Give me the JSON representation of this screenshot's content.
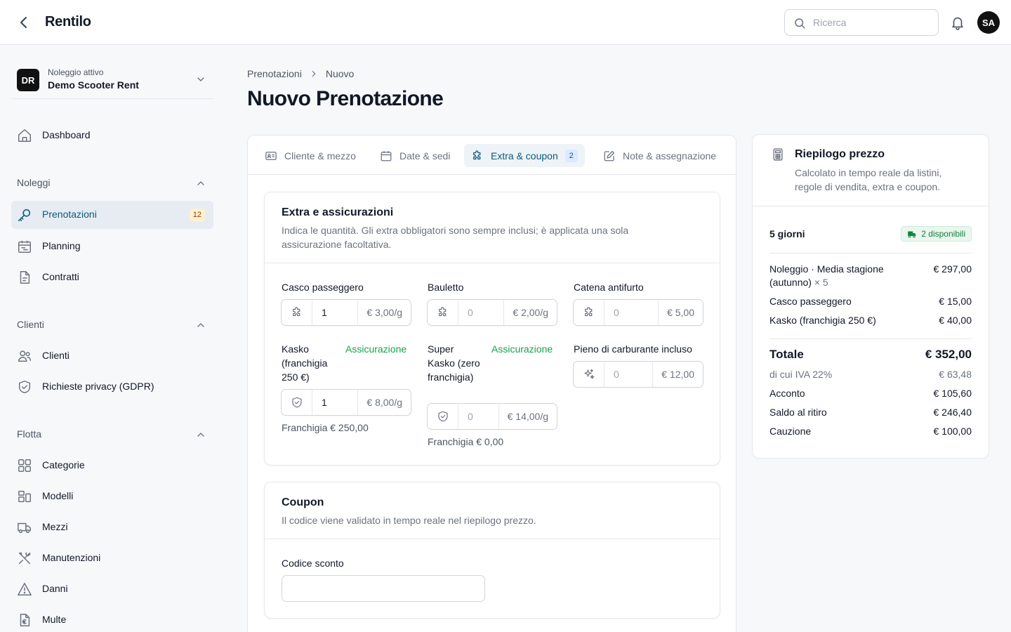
{
  "app": {
    "name": "Rentilo"
  },
  "header": {
    "search_placeholder": "Ricerca",
    "user_initials": "SA"
  },
  "sidebar": {
    "tenant": {
      "badge": "DR",
      "subtitle": "Noleggio attivo",
      "name": "Demo Scooter Rent"
    },
    "dashboard": "Dashboard",
    "groups": {
      "noleggi": {
        "label": "Noleggi",
        "items": {
          "prenotazioni": "Prenotazioni",
          "prenotazioni_count": "12",
          "planning": "Planning",
          "contratti": "Contratti"
        }
      },
      "clienti": {
        "label": "Clienti",
        "items": {
          "clienti": "Clienti",
          "privacy": "Richieste privacy (GDPR)"
        }
      },
      "flotta": {
        "label": "Flotta",
        "items": {
          "categorie": "Categorie",
          "modelli": "Modelli",
          "mezzi": "Mezzi",
          "manutenzioni": "Manutenzioni",
          "danni": "Danni",
          "multe": "Multe"
        }
      }
    }
  },
  "breadcrumb": {
    "parent": "Prenotazioni",
    "current": "Nuovo"
  },
  "page": {
    "title": "Nuovo Prenotazione"
  },
  "tabs": [
    {
      "label": "Cliente & mezzo",
      "icon": "id-card-icon"
    },
    {
      "label": "Date & sedi",
      "icon": "calendar-icon"
    },
    {
      "label": "Extra & coupon",
      "icon": "puzzle-icon",
      "badge": "2",
      "active": true
    },
    {
      "label": "Note & assegnazione",
      "icon": "edit-icon"
    }
  ],
  "extras": {
    "title": "Extra e assicurazioni",
    "description": "Indica le quantità. Gli extra obbligatori sono sempre inclusi; è applicata una sola assicurazione facoltativa.",
    "items": [
      {
        "label": "Casco passeggero",
        "value": "1",
        "placeholder": "0",
        "price": "€ 3,00/g",
        "icon": "puzzle-icon"
      },
      {
        "label": "Bauletto",
        "value": "",
        "placeholder": "0",
        "price": "€ 2,00/g",
        "icon": "puzzle-icon"
      },
      {
        "label": "Catena antifurto",
        "value": "",
        "placeholder": "0",
        "price": "€ 5,00",
        "icon": "puzzle-icon"
      },
      {
        "label": "Kasko (franchigia 250 €)",
        "tag": "Assicurazione",
        "value": "1",
        "placeholder": "0",
        "price": "€ 8,00/g",
        "icon": "shield-icon",
        "note": "Franchigia € 250,00"
      },
      {
        "label": "Super Kasko (zero franchigia)",
        "tag": "Assicurazione",
        "value": "",
        "placeholder": "0",
        "price": "€ 14,00/g",
        "icon": "shield-icon",
        "note": "Franchigia € 0,00"
      },
      {
        "label": "Pieno di carburante incluso",
        "value": "",
        "placeholder": "0",
        "price": "€ 12,00",
        "icon": "sparkle-icon"
      }
    ]
  },
  "coupon": {
    "title": "Coupon",
    "description": "Il codice viene validato in tempo reale nel riepilogo prezzo.",
    "field_label": "Codice sconto",
    "value": ""
  },
  "summary": {
    "title": "Riepilogo prezzo",
    "description": "Calcolato in tempo reale da listini, regole di vendita, extra e coupon.",
    "days": "5 giorni",
    "availability": "2 disponibili",
    "lines": [
      {
        "label": "Noleggio · Media stagione (autunno)",
        "mult": "× 5",
        "value": "€ 297,00"
      },
      {
        "label": "Casco passeggero",
        "value": "€ 15,00"
      },
      {
        "label": "Kasko (franchigia 250 €)",
        "value": "€ 40,00"
      }
    ],
    "total": {
      "label": "Totale",
      "value": "€ 352,00"
    },
    "vat": {
      "label": "di cui IVA 22%",
      "value": "€ 63,48"
    },
    "deposit": {
      "label": "Acconto",
      "value": "€ 105,60"
    },
    "balance": {
      "label": "Saldo al ritiro",
      "value": "€ 246,40"
    },
    "security": {
      "label": "Cauzione",
      "value": "€ 100,00"
    }
  },
  "colors": {
    "accent": "#0b5a7a",
    "active_bg": "#e6ecf2",
    "insurance": "#16a34a",
    "badge_bg": "#fdf1cf"
  }
}
